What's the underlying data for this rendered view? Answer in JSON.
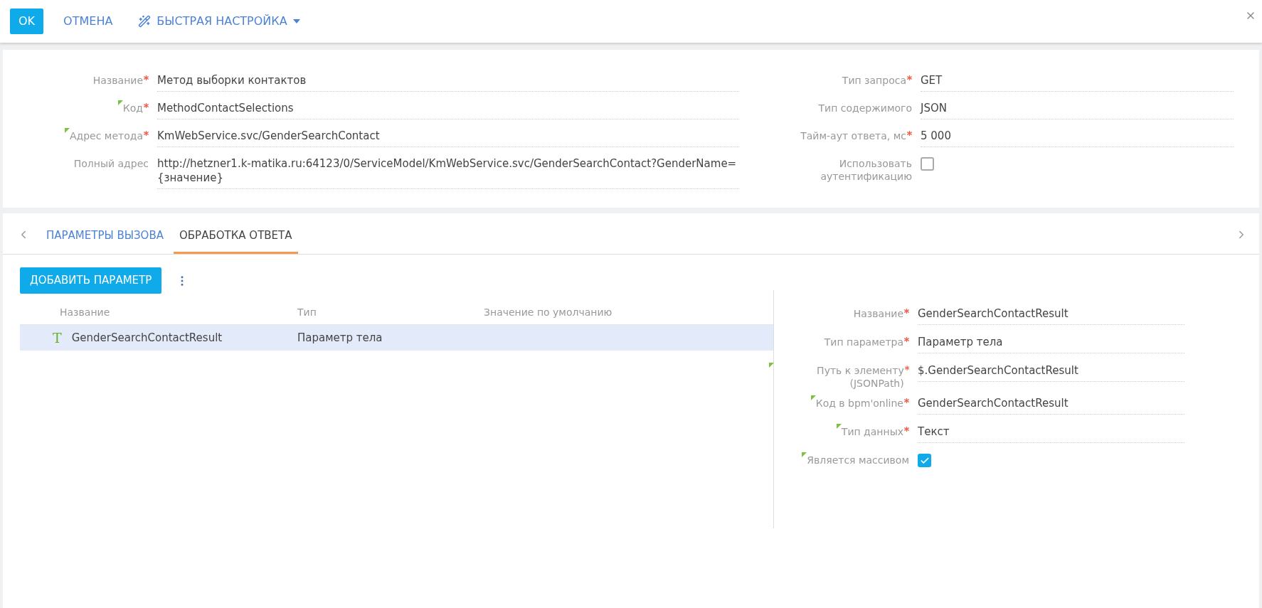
{
  "toolbar": {
    "ok": "OK",
    "cancel": "ОТМЕНА",
    "quick_setup": "БЫСТРАЯ НАСТРОЙКА"
  },
  "main_form": {
    "left": [
      {
        "kind": "text",
        "label": "Название",
        "required": true,
        "hint": false,
        "value": "Метод выборки контактов"
      },
      {
        "kind": "text",
        "label": "Код",
        "required": true,
        "hint": true,
        "value": "MethodContactSelections"
      },
      {
        "kind": "text",
        "label": "Адрес метода",
        "required": true,
        "hint": true,
        "value": "KmWebService.svc/GenderSearchContact"
      },
      {
        "kind": "text",
        "label": "Полный адрес",
        "required": false,
        "hint": false,
        "value": "http://hetzner1.k-matika.ru:64123/0/ServiceModel/KmWebService.svc/GenderSearchContact?GenderName={значение}"
      }
    ],
    "right": [
      {
        "kind": "text",
        "label": "Тип запроса",
        "required": true,
        "hint": false,
        "value": "GET"
      },
      {
        "kind": "text",
        "label": "Тип содержимого",
        "required": false,
        "hint": false,
        "value": "JSON"
      },
      {
        "kind": "text",
        "label": "Тайм-аут ответа, мс",
        "required": true,
        "hint": false,
        "value": "5 000"
      },
      {
        "kind": "checkbox",
        "label": "Использовать аутентификацию",
        "required": false,
        "hint": false,
        "checked": false
      }
    ]
  },
  "tabs": [
    {
      "label": "ПАРАМЕТРЫ ВЫЗОВА",
      "selected": false
    },
    {
      "label": "ОБРАБОТКА ОТВЕТА",
      "selected": true
    }
  ],
  "add_button": "ДОБАВИТЬ ПАРАМЕТР",
  "table": {
    "columns": [
      "Название",
      "Тип",
      "Значение по умолчанию"
    ],
    "rows": [
      {
        "icon": "T",
        "name": "GenderSearchContactResult",
        "type": "Параметр тела",
        "selected": true
      }
    ]
  },
  "param_form": [
    {
      "kind": "text",
      "label": "Название",
      "required": true,
      "hint": false,
      "value": "GenderSearchContactResult"
    },
    {
      "kind": "text",
      "label": "Тип параметра",
      "required": true,
      "hint": false,
      "value": "Параметр тела"
    },
    {
      "kind": "text",
      "label": "Путь к элементу (JSONPath)",
      "required": true,
      "hint": true,
      "value": "$.GenderSearchContactResult"
    },
    {
      "kind": "text",
      "label": "Код в bpm'online",
      "required": true,
      "hint": true,
      "value": "GenderSearchContactResult"
    },
    {
      "kind": "text",
      "label": "Тип данных",
      "required": true,
      "hint": true,
      "value": "Текст"
    },
    {
      "kind": "checkbox",
      "label": "Является массивом",
      "required": false,
      "hint": true,
      "checked": true
    }
  ]
}
